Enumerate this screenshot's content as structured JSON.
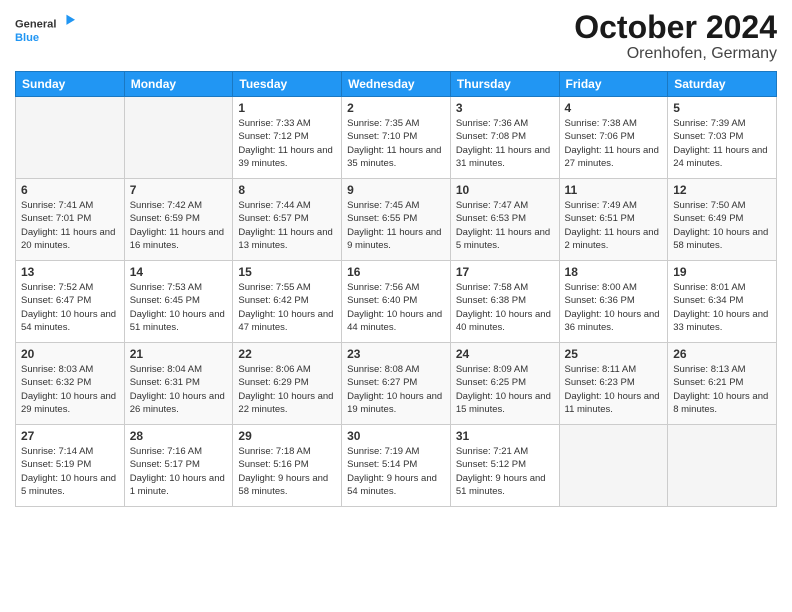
{
  "header": {
    "logo_general": "General",
    "logo_blue": "Blue",
    "month": "October 2024",
    "location": "Orenhofen, Germany"
  },
  "days_of_week": [
    "Sunday",
    "Monday",
    "Tuesday",
    "Wednesday",
    "Thursday",
    "Friday",
    "Saturday"
  ],
  "weeks": [
    [
      {
        "day": "",
        "info": ""
      },
      {
        "day": "",
        "info": ""
      },
      {
        "day": "1",
        "info": "Sunrise: 7:33 AM\nSunset: 7:12 PM\nDaylight: 11 hours and 39 minutes."
      },
      {
        "day": "2",
        "info": "Sunrise: 7:35 AM\nSunset: 7:10 PM\nDaylight: 11 hours and 35 minutes."
      },
      {
        "day": "3",
        "info": "Sunrise: 7:36 AM\nSunset: 7:08 PM\nDaylight: 11 hours and 31 minutes."
      },
      {
        "day": "4",
        "info": "Sunrise: 7:38 AM\nSunset: 7:06 PM\nDaylight: 11 hours and 27 minutes."
      },
      {
        "day": "5",
        "info": "Sunrise: 7:39 AM\nSunset: 7:03 PM\nDaylight: 11 hours and 24 minutes."
      }
    ],
    [
      {
        "day": "6",
        "info": "Sunrise: 7:41 AM\nSunset: 7:01 PM\nDaylight: 11 hours and 20 minutes."
      },
      {
        "day": "7",
        "info": "Sunrise: 7:42 AM\nSunset: 6:59 PM\nDaylight: 11 hours and 16 minutes."
      },
      {
        "day": "8",
        "info": "Sunrise: 7:44 AM\nSunset: 6:57 PM\nDaylight: 11 hours and 13 minutes."
      },
      {
        "day": "9",
        "info": "Sunrise: 7:45 AM\nSunset: 6:55 PM\nDaylight: 11 hours and 9 minutes."
      },
      {
        "day": "10",
        "info": "Sunrise: 7:47 AM\nSunset: 6:53 PM\nDaylight: 11 hours and 5 minutes."
      },
      {
        "day": "11",
        "info": "Sunrise: 7:49 AM\nSunset: 6:51 PM\nDaylight: 11 hours and 2 minutes."
      },
      {
        "day": "12",
        "info": "Sunrise: 7:50 AM\nSunset: 6:49 PM\nDaylight: 10 hours and 58 minutes."
      }
    ],
    [
      {
        "day": "13",
        "info": "Sunrise: 7:52 AM\nSunset: 6:47 PM\nDaylight: 10 hours and 54 minutes."
      },
      {
        "day": "14",
        "info": "Sunrise: 7:53 AM\nSunset: 6:45 PM\nDaylight: 10 hours and 51 minutes."
      },
      {
        "day": "15",
        "info": "Sunrise: 7:55 AM\nSunset: 6:42 PM\nDaylight: 10 hours and 47 minutes."
      },
      {
        "day": "16",
        "info": "Sunrise: 7:56 AM\nSunset: 6:40 PM\nDaylight: 10 hours and 44 minutes."
      },
      {
        "day": "17",
        "info": "Sunrise: 7:58 AM\nSunset: 6:38 PM\nDaylight: 10 hours and 40 minutes."
      },
      {
        "day": "18",
        "info": "Sunrise: 8:00 AM\nSunset: 6:36 PM\nDaylight: 10 hours and 36 minutes."
      },
      {
        "day": "19",
        "info": "Sunrise: 8:01 AM\nSunset: 6:34 PM\nDaylight: 10 hours and 33 minutes."
      }
    ],
    [
      {
        "day": "20",
        "info": "Sunrise: 8:03 AM\nSunset: 6:32 PM\nDaylight: 10 hours and 29 minutes."
      },
      {
        "day": "21",
        "info": "Sunrise: 8:04 AM\nSunset: 6:31 PM\nDaylight: 10 hours and 26 minutes."
      },
      {
        "day": "22",
        "info": "Sunrise: 8:06 AM\nSunset: 6:29 PM\nDaylight: 10 hours and 22 minutes."
      },
      {
        "day": "23",
        "info": "Sunrise: 8:08 AM\nSunset: 6:27 PM\nDaylight: 10 hours and 19 minutes."
      },
      {
        "day": "24",
        "info": "Sunrise: 8:09 AM\nSunset: 6:25 PM\nDaylight: 10 hours and 15 minutes."
      },
      {
        "day": "25",
        "info": "Sunrise: 8:11 AM\nSunset: 6:23 PM\nDaylight: 10 hours and 11 minutes."
      },
      {
        "day": "26",
        "info": "Sunrise: 8:13 AM\nSunset: 6:21 PM\nDaylight: 10 hours and 8 minutes."
      }
    ],
    [
      {
        "day": "27",
        "info": "Sunrise: 7:14 AM\nSunset: 5:19 PM\nDaylight: 10 hours and 5 minutes."
      },
      {
        "day": "28",
        "info": "Sunrise: 7:16 AM\nSunset: 5:17 PM\nDaylight: 10 hours and 1 minute."
      },
      {
        "day": "29",
        "info": "Sunrise: 7:18 AM\nSunset: 5:16 PM\nDaylight: 9 hours and 58 minutes."
      },
      {
        "day": "30",
        "info": "Sunrise: 7:19 AM\nSunset: 5:14 PM\nDaylight: 9 hours and 54 minutes."
      },
      {
        "day": "31",
        "info": "Sunrise: 7:21 AM\nSunset: 5:12 PM\nDaylight: 9 hours and 51 minutes."
      },
      {
        "day": "",
        "info": ""
      },
      {
        "day": "",
        "info": ""
      }
    ]
  ]
}
